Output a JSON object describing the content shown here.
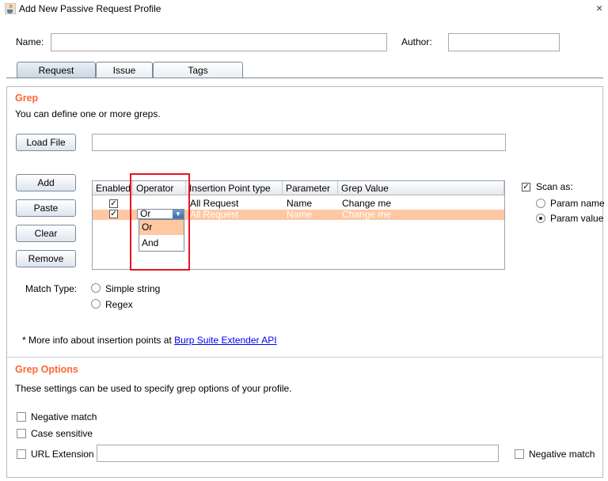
{
  "window": {
    "title": "Add New Passive Request Profile",
    "close_symbol": "×"
  },
  "header": {
    "name_label": "Name:",
    "name_value": "",
    "author_label": "Author:",
    "author_value": ""
  },
  "tabs": [
    {
      "label": "Request",
      "active": true
    },
    {
      "label": "Issue",
      "active": false
    },
    {
      "label": "Tags",
      "active": false
    }
  ],
  "grep": {
    "title": "Grep",
    "description": "You can define one or more greps.",
    "load_file_button": "Load File",
    "file_path": "",
    "buttons": {
      "add": "Add",
      "paste": "Paste",
      "clear": "Clear",
      "remove": "Remove"
    },
    "table": {
      "headers": [
        "Enabled",
        "Operator",
        "Insertion Point type",
        "Parameter",
        "Grep Value"
      ],
      "rows": [
        {
          "enabled": true,
          "operator": "",
          "insertion_point": "All Request",
          "parameter": "Name",
          "grep_value": "Change me"
        },
        {
          "enabled": true,
          "operator": "Or",
          "insertion_point": "All Request",
          "parameter": "Name",
          "grep_value": "Change me"
        }
      ]
    },
    "operator_options": [
      "Or",
      "And"
    ],
    "scan_as": {
      "label": "Scan as:",
      "checked": true,
      "options": [
        "Param name",
        "Param value"
      ],
      "selected": "Param value"
    },
    "match_type": {
      "label": "Match Type:",
      "options": [
        "Simple string",
        "Regex"
      ]
    },
    "info": {
      "prefix": "* More info about insertion points at ",
      "link_text": "Burp Suite Extender API"
    }
  },
  "grep_options": {
    "title": "Grep Options",
    "description": "These settings can be used to specify grep options of your profile.",
    "negative_match": "Negative match",
    "case_sensitive": "Case sensitive",
    "url_extension": "URL Extension",
    "url_extension_value": "",
    "negative_match_right": "Negative match"
  },
  "colors": {
    "section_title": "#ff6633",
    "selection": "#ffc8a2",
    "highlight_box": "#e8141e",
    "link": "#0000ee"
  },
  "icons": {
    "window": "java-cup-icon",
    "dropdown": "chevron-down-icon"
  }
}
